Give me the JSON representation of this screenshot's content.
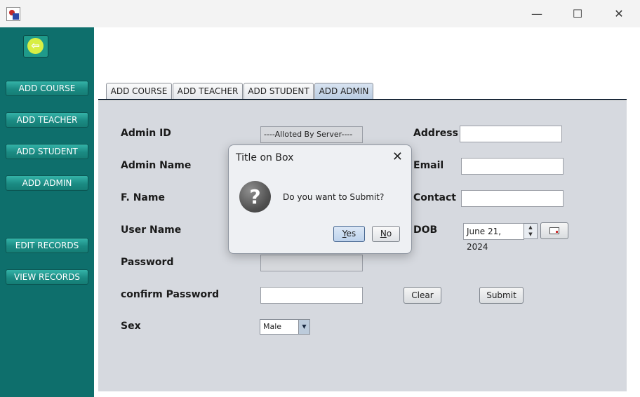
{
  "titlebar": {
    "minimize_glyph": "—",
    "maximize_glyph": "☐",
    "close_glyph": "✕"
  },
  "sidebar": {
    "back_glyph": "⇦",
    "items": [
      {
        "label": "ADD COURSE"
      },
      {
        "label": "ADD TEACHER"
      },
      {
        "label": "ADD STUDENT"
      },
      {
        "label": "ADD ADMIN"
      },
      {
        "label": "EDIT RECORDS"
      },
      {
        "label": "VIEW RECORDS"
      }
    ]
  },
  "tabs": [
    {
      "label": "ADD COURSE"
    },
    {
      "label": "ADD TEACHER"
    },
    {
      "label": "ADD STUDENT"
    },
    {
      "label": "ADD ADMIN",
      "active": true
    }
  ],
  "form": {
    "admin_id_label": "Admin ID",
    "admin_id_value": "----Alloted By Server----",
    "admin_name_label": "Admin Name",
    "fname_label": "F. Name",
    "username_label": "User Name",
    "password_label": "Password",
    "confirm_password_label": "confirm Password",
    "sex_label": "Sex",
    "sex_value": "Male",
    "address_label": "Address",
    "email_label": "Email",
    "contact_label": "Contact",
    "dob_label": "DOB",
    "dob_value": "June 21, 2024",
    "clear_label": "Clear",
    "submit_label": "Submit"
  },
  "dialog": {
    "title": "Title on Box",
    "close_glyph": "✕",
    "icon_glyph": "?",
    "message": "Do you want to Submit?",
    "yes_mnemonic": "Y",
    "yes_rest": "es",
    "no_mnemonic": "N",
    "no_rest": "o"
  },
  "colors": {
    "sidebar_bg": "#0e6f6c",
    "panel_bg": "#d6d9df",
    "nav_button": "#1b8b83"
  }
}
